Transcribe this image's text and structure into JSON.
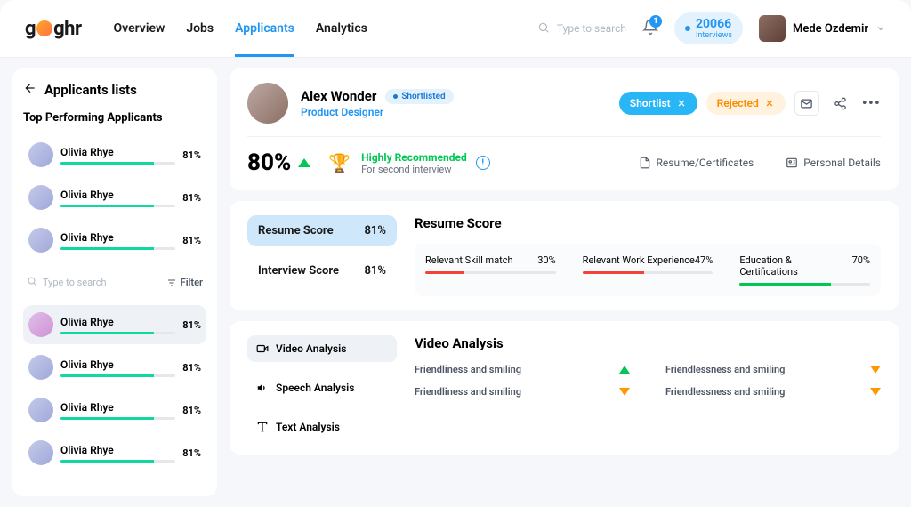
{
  "brand": "goghr",
  "nav": [
    "Overview",
    "Jobs",
    "Applicants",
    "Analytics"
  ],
  "nav_active": 2,
  "search_placeholder": "Type to search",
  "bell_count": "1",
  "interviews": {
    "count": "20066",
    "label": "Interviews"
  },
  "user": "Mede Ozdemir",
  "sidebar": {
    "title": "Applicants lists",
    "subtitle": "Top Performing Applicants",
    "top": [
      {
        "name": "Olivia Rhye",
        "pct": "81%"
      },
      {
        "name": "Olivia Rhye",
        "pct": "81%"
      },
      {
        "name": "Olivia Rhye",
        "pct": "81%"
      }
    ],
    "search_placeholder": "Type to search",
    "filter_label": "Filter",
    "list": [
      {
        "name": "Olivia Rhye",
        "pct": "81%",
        "selected": true
      },
      {
        "name": "Olivia Rhye",
        "pct": "81%"
      },
      {
        "name": "Olivia Rhye",
        "pct": "81%"
      },
      {
        "name": "Olivia Rhye",
        "pct": "81%"
      }
    ]
  },
  "applicant": {
    "name": "Alex Wonder",
    "role": "Product Designer",
    "status": "Shortlisted",
    "actions": {
      "shortlist": "Shortlist",
      "rejected": "Rejected"
    },
    "score": "80%",
    "recommendation": {
      "title": "Highly Recommended",
      "sub": "For second interview"
    },
    "links": {
      "resume": "Resume/Certificates",
      "personal": "Personal Details"
    }
  },
  "resume": {
    "tabs": [
      {
        "label": "Resume Score",
        "value": "81%",
        "active": true
      },
      {
        "label": "Interview Score",
        "value": "81%"
      }
    ],
    "title": "Resume Score",
    "metrics": [
      {
        "label": "Relevant Skill match",
        "value": "30%",
        "pct": 30,
        "color": "#f44336"
      },
      {
        "label": "Relevant Work Experience",
        "value": "47%",
        "pct": 47,
        "color": "#f44336"
      },
      {
        "label": "Education & Certifications",
        "value": "70%",
        "pct": 70,
        "color": "#00c853"
      }
    ]
  },
  "video": {
    "title": "Video Analysis",
    "tabs": [
      "Video Analysis",
      "Speech Analysis",
      "Text Analysis"
    ],
    "items": [
      {
        "label": "Friendliness and smiling",
        "dir": "up"
      },
      {
        "label": "Friendlessness and smiling",
        "dir": "down"
      },
      {
        "label": "Friendliness and smiling",
        "dir": "down"
      },
      {
        "label": "Friendlessness and smiling",
        "dir": "down"
      }
    ]
  }
}
